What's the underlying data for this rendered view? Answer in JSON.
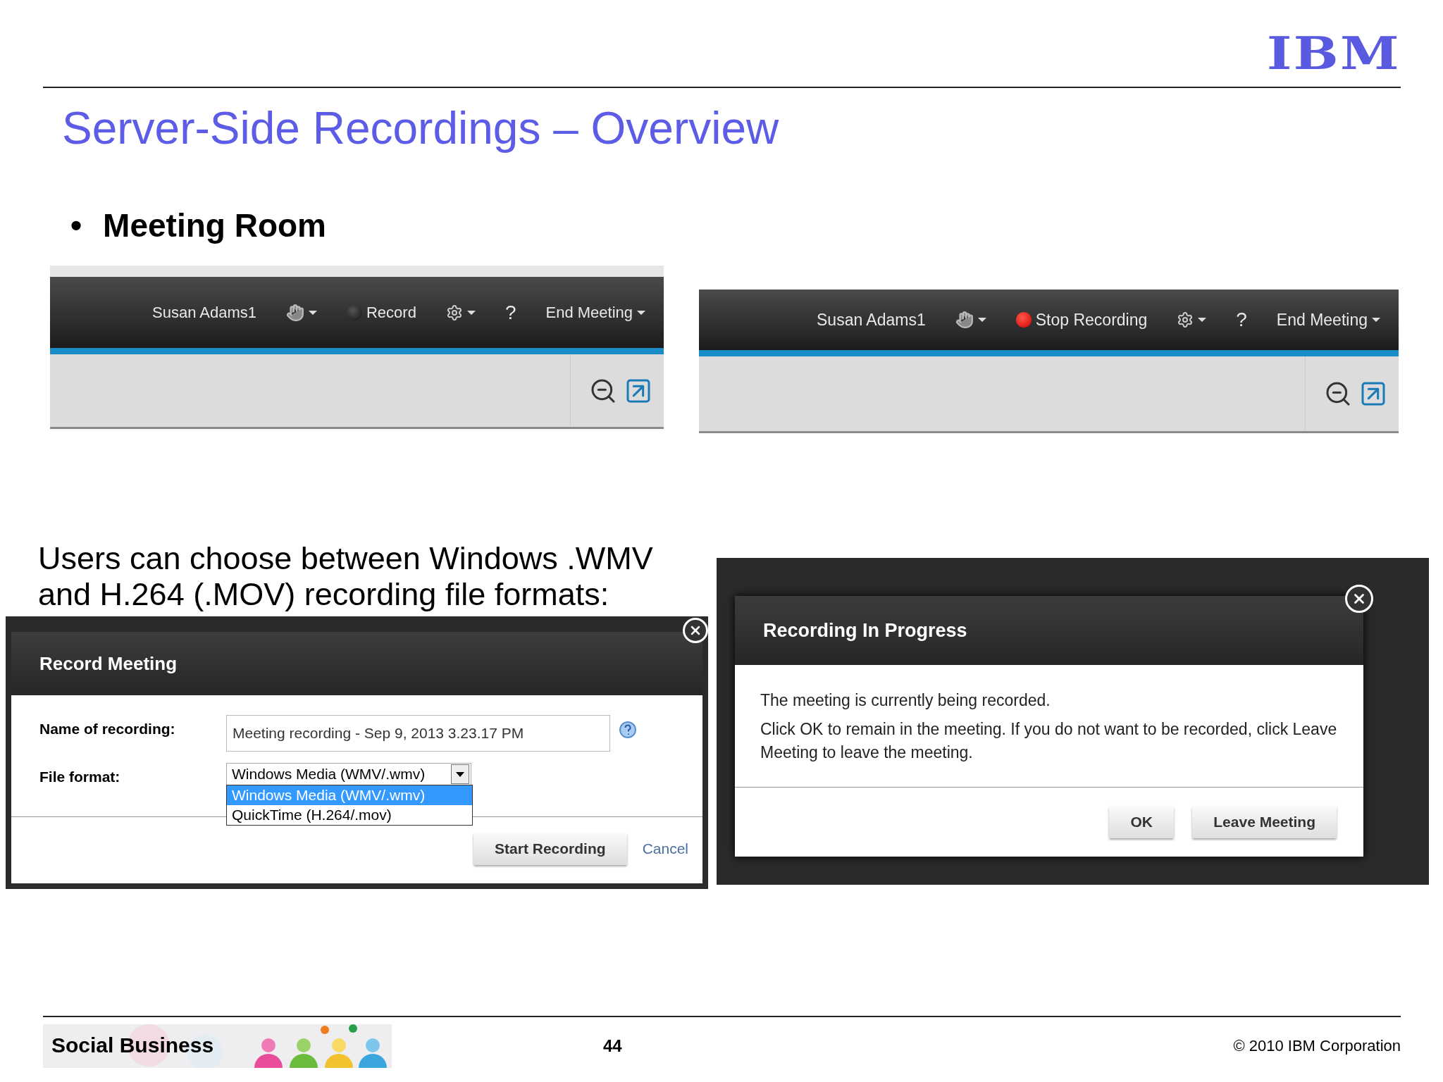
{
  "logo": {
    "text": "IBM"
  },
  "title": "Server-Side Recordings – Overview",
  "bullet": {
    "marker": "•",
    "text": "Meeting Room"
  },
  "toolbars": [
    {
      "user": "Susan Adams1",
      "record": {
        "label": "Record",
        "recording": false
      },
      "help": "?",
      "end": "End Meeting"
    },
    {
      "user": "Susan Adams1",
      "record": {
        "label": "Stop Recording",
        "recording": true
      },
      "help": "?",
      "end": "End Meeting"
    }
  ],
  "intro": "Users can choose between Windows .WMV and H.264 (.MOV) recording file formats:",
  "record_dialog": {
    "title": "Record Meeting",
    "name_label": "Name of recording:",
    "name_value": "Meeting recording - Sep 9, 2013 3.23.17 PM",
    "format_label": "File format:",
    "format_value": "Windows Media (WMV/.wmv)",
    "options": [
      {
        "label": "Windows Media (WMV/.wmv)",
        "selected": true
      },
      {
        "label": "QuickTime (H.264/.mov)",
        "selected": false
      }
    ],
    "start": "Start Recording",
    "cancel": "Cancel"
  },
  "progress_dialog": {
    "title": "Recording In Progress",
    "lines": [
      "The meeting is currently being recorded.",
      "Click OK to remain in the meeting. If you do not want to be recorded, click Leave Meeting to leave the meeting."
    ],
    "buttons": [
      "OK",
      "Leave Meeting"
    ]
  },
  "footer": {
    "banner": "Social Business",
    "page": "44",
    "copyright": "© 2010 IBM Corporation"
  }
}
